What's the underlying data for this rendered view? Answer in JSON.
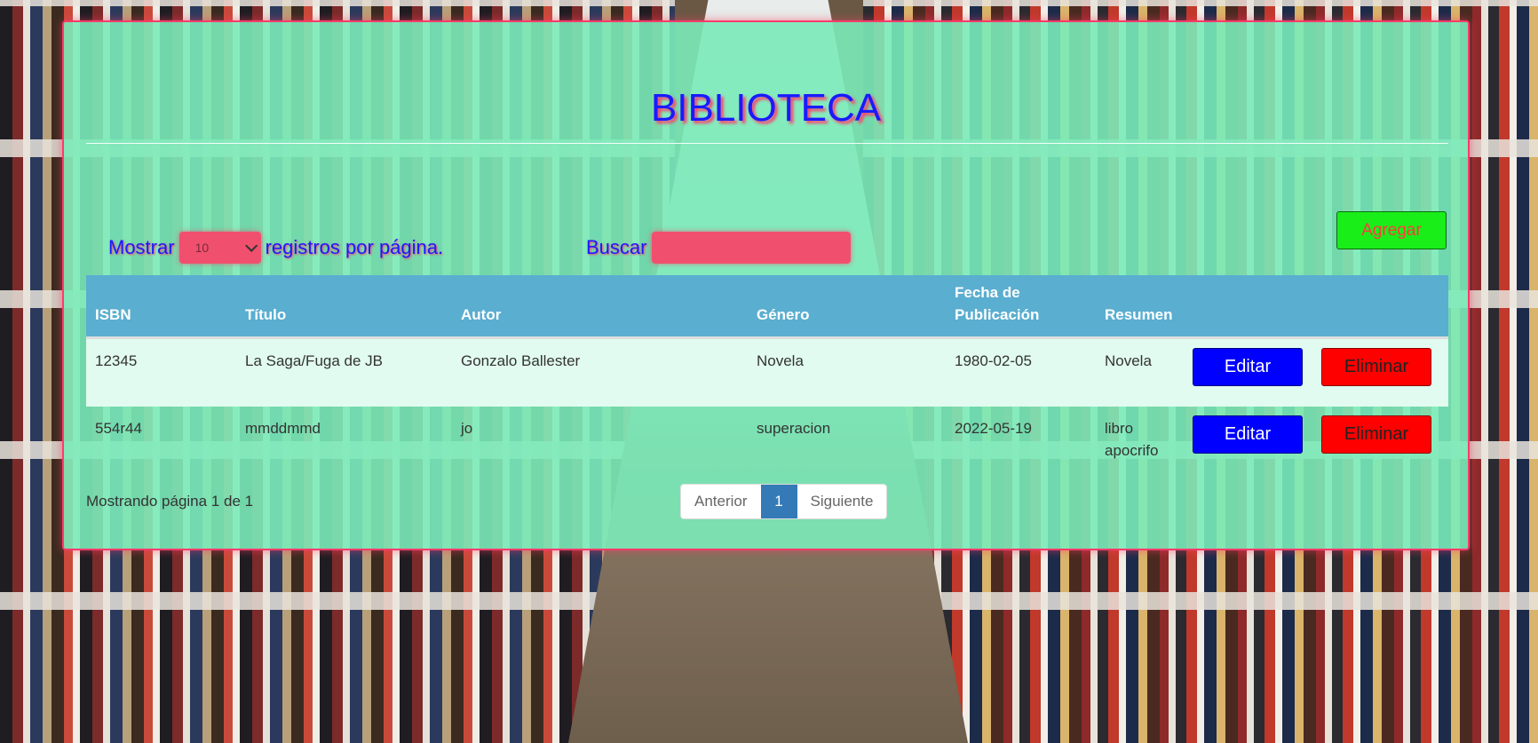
{
  "page": {
    "title": "BIBLIOTECA"
  },
  "controls": {
    "show_label": "Mostrar",
    "page_size": "10",
    "per_page_label": "registros por página.",
    "search_label": "Buscar",
    "search_value": "",
    "add_label": "Agregar"
  },
  "table": {
    "columns": [
      "ISBN",
      "Título",
      "Autor",
      "Género",
      "Fecha de Publicación",
      "Resumen"
    ],
    "rows": [
      {
        "isbn": "12345",
        "titulo": "La Saga/Fuga de JB",
        "autor": "Gonzalo Ballester",
        "genero": "Novela",
        "fecha": "1980-02-05",
        "resumen": "Novela"
      },
      {
        "isbn": "554r44",
        "titulo": "mmddmmd",
        "autor": "jo",
        "genero": "superacion",
        "fecha": "2022-05-19",
        "resumen": "libro apocrifo"
      }
    ],
    "edit_label": "Editar",
    "delete_label": "Eliminar"
  },
  "footer": {
    "status": "Mostrando página 1 de 1",
    "prev_label": "Anterior",
    "current_page": "1",
    "next_label": "Siguiente"
  },
  "colors": {
    "panel": "#7aebb9",
    "title": "#1a1aff",
    "accent_pink": "#ff3b6b",
    "add_button": "#19ee19",
    "edit_button": "#0000ff",
    "delete_button": "#ff0000",
    "table_header": "#5aaed0",
    "pager_active": "#337ab7"
  }
}
